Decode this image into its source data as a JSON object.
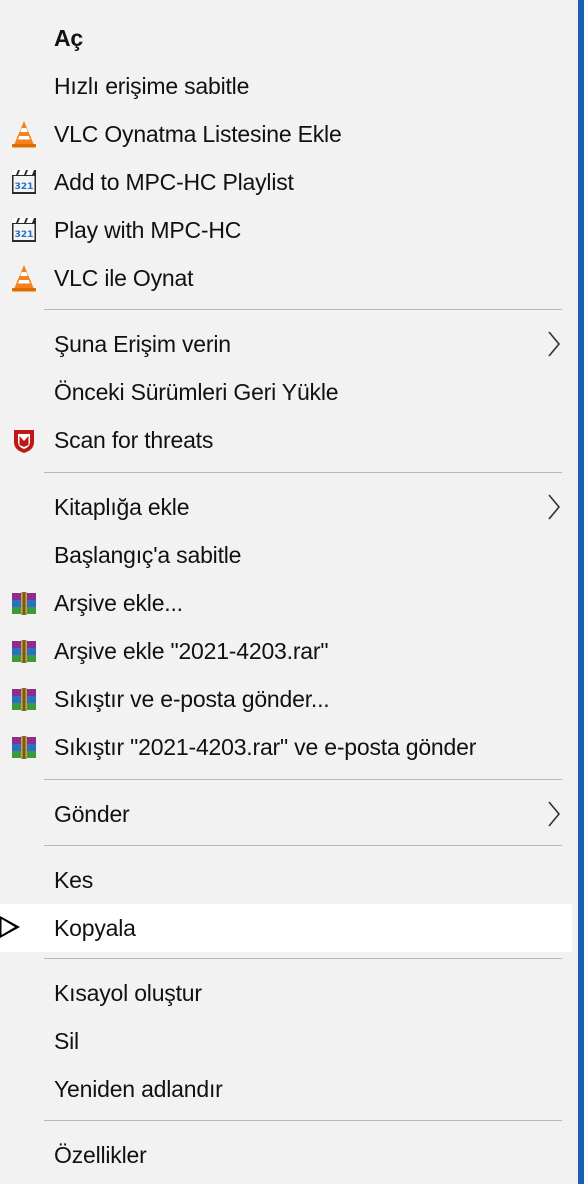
{
  "menu": {
    "items": [
      {
        "label": "Aç",
        "bold": true,
        "icon": "",
        "submenu": false
      },
      {
        "label": "Hızlı erişime sabitle",
        "icon": "",
        "submenu": false
      },
      {
        "label": "VLC Oynatma Listesine Ekle",
        "icon": "vlc-cone-icon",
        "submenu": false
      },
      {
        "label": "Add to MPC-HC Playlist",
        "icon": "mpc-hc-icon",
        "submenu": false
      },
      {
        "label": "Play with MPC-HC",
        "icon": "mpc-hc-icon",
        "submenu": false
      },
      {
        "label": "VLC ile Oynat",
        "icon": "vlc-cone-icon",
        "submenu": false
      },
      {
        "label": "Şuna Erişim verin",
        "icon": "",
        "submenu": true
      },
      {
        "label": "Önceki Sürümleri Geri Yükle",
        "icon": "",
        "submenu": false
      },
      {
        "label": "Scan for threats",
        "icon": "mcafee-shield-icon",
        "submenu": false
      },
      {
        "label": "Kitaplığa ekle",
        "icon": "",
        "submenu": true
      },
      {
        "label": "Başlangıç'a sabitle",
        "icon": "",
        "submenu": false
      },
      {
        "label": "Arşive ekle...",
        "icon": "winrar-icon",
        "submenu": false
      },
      {
        "label": "Arşive ekle \"2021-4203.rar\"",
        "icon": "winrar-icon",
        "submenu": false
      },
      {
        "label": "Sıkıştır ve e-posta gönder...",
        "icon": "winrar-icon",
        "submenu": false
      },
      {
        "label": "Sıkıştır \"2021-4203.rar\" ve e-posta gönder",
        "icon": "winrar-icon",
        "submenu": false
      },
      {
        "label": "Gönder",
        "icon": "",
        "submenu": true
      },
      {
        "label": "Kes",
        "icon": "",
        "submenu": false
      },
      {
        "label": "Kopyala",
        "icon": "",
        "submenu": false,
        "hovered": true
      },
      {
        "label": "Kısayol oluştur",
        "icon": "",
        "submenu": false
      },
      {
        "label": "Sil",
        "icon": "",
        "submenu": false
      },
      {
        "label": "Yeniden adlandır",
        "icon": "",
        "submenu": false
      },
      {
        "label": "Özellikler",
        "icon": "",
        "submenu": false
      }
    ]
  },
  "colors": {
    "menu_background": "#f2f2f2",
    "hover_background": "#ffffff",
    "separator": "#b9b9b9",
    "window_edge": "#1a5fb4"
  }
}
